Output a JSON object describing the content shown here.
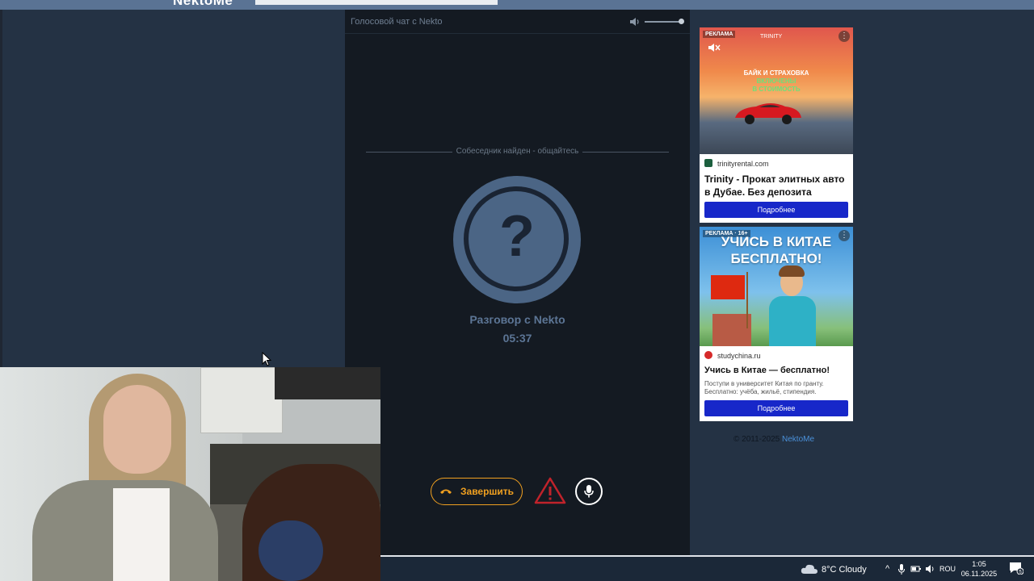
{
  "top_bar": {
    "logo": "NektoMe"
  },
  "chat": {
    "title": "Голосовой чат с Nekto",
    "status": "Собеседник найден - общайтесь",
    "avatar_symbol": "?",
    "partner_name": "Разговор с Nekto",
    "timer": "05:37",
    "end_button_label": "Завершить",
    "icons": [
      "speaker-icon",
      "phone-hangup-icon",
      "warning-icon",
      "microphone-icon"
    ],
    "accent_color": "#f0a020"
  },
  "ads": [
    {
      "badge": "РЕКЛАМА",
      "brand": "TRINITY",
      "slogan_line1": "БАЙК И СТРАХОВКА",
      "slogan_line2": "ВКЛЮЧЕНЫ",
      "slogan_line3": "В СТОИМОСТЬ",
      "domain": "trinityrental.com",
      "title": "Trinity - Прокат элитных авто в Дубае. Без депозита",
      "button": "Подробнее"
    },
    {
      "badge": "РЕКЛАМА · 16+",
      "headline_line1": "УЧИСЬ В КИТАЕ",
      "headline_line2": "БЕСПЛАТНО!",
      "domain": "studychina.ru",
      "title": "Учись в Китае — бесплатно!",
      "description": "Поступи в университет Китая по гранту. Бесплатно: учёба, жильё, стипендия.",
      "button": "Подробнее"
    }
  ],
  "footer": {
    "copyright": "© 2011-2025",
    "link": "NektoMe"
  },
  "taskbar": {
    "weather": "8°C  Cloudy",
    "language": "ROU",
    "time": "1:05",
    "date": "06.11.2025",
    "notification_count": "5"
  }
}
